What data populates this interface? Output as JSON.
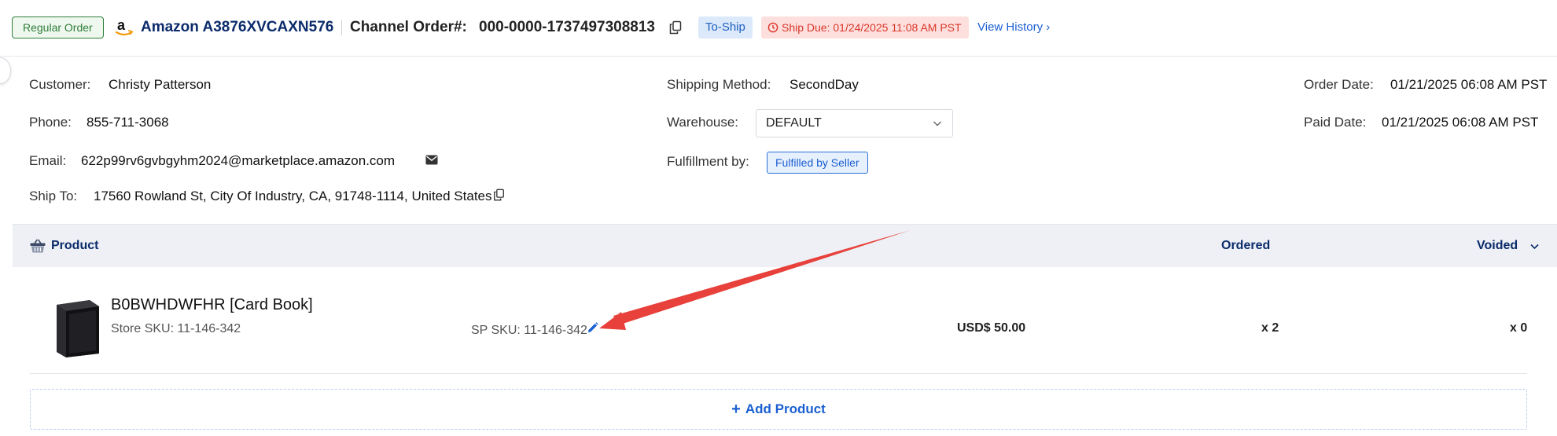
{
  "header": {
    "order_type": "Regular Order",
    "store_name": "Amazon A3876XVCAXN576",
    "channel_label": "Channel Order#:",
    "channel_order_no": "000-0000-1737497308813",
    "status": "To-Ship",
    "ship_due": "Ship Due: 01/24/2025 11:08 AM PST",
    "view_history": "View History ›"
  },
  "info": {
    "customer_label": "Customer:",
    "customer": "Christy Patterson",
    "phone_label": "Phone:",
    "phone": "855-711-3068",
    "email_label": "Email:",
    "email": "622p99rv6gvbgyhm2024@marketplace.amazon.com",
    "ship_to_label": "Ship To:",
    "ship_to": "17560 Rowland St, City Of Industry, CA, 91748-1114, United States",
    "shipping_method_label": "Shipping Method:",
    "shipping_method": "SecondDay",
    "warehouse_label": "Warehouse:",
    "warehouse": "DEFAULT",
    "fulfillment_label": "Fulfillment by:",
    "fulfillment": "Fulfilled by Seller",
    "order_date_label": "Order Date:",
    "order_date": "01/21/2025 06:08 AM PST",
    "paid_date_label": "Paid Date:",
    "paid_date": "01/21/2025 06:08 AM PST"
  },
  "table": {
    "product_header": "Product",
    "ordered_header": "Ordered",
    "voided_header": "Voided"
  },
  "product": {
    "title": "B0BWHDWFHR [Card Book]",
    "store_sku": "Store SKU: 11-146-342",
    "sp_sku": "SP SKU: 11-146-342",
    "price": "USD$ 50.00",
    "ordered": "x 2",
    "voided": "x 0"
  },
  "add_product": "Add Product",
  "colors": {
    "brand_blue": "#1a5fd1",
    "navy": "#0b2b6b",
    "due_red": "#d9362b",
    "annotation_arrow": "#e8403a"
  }
}
